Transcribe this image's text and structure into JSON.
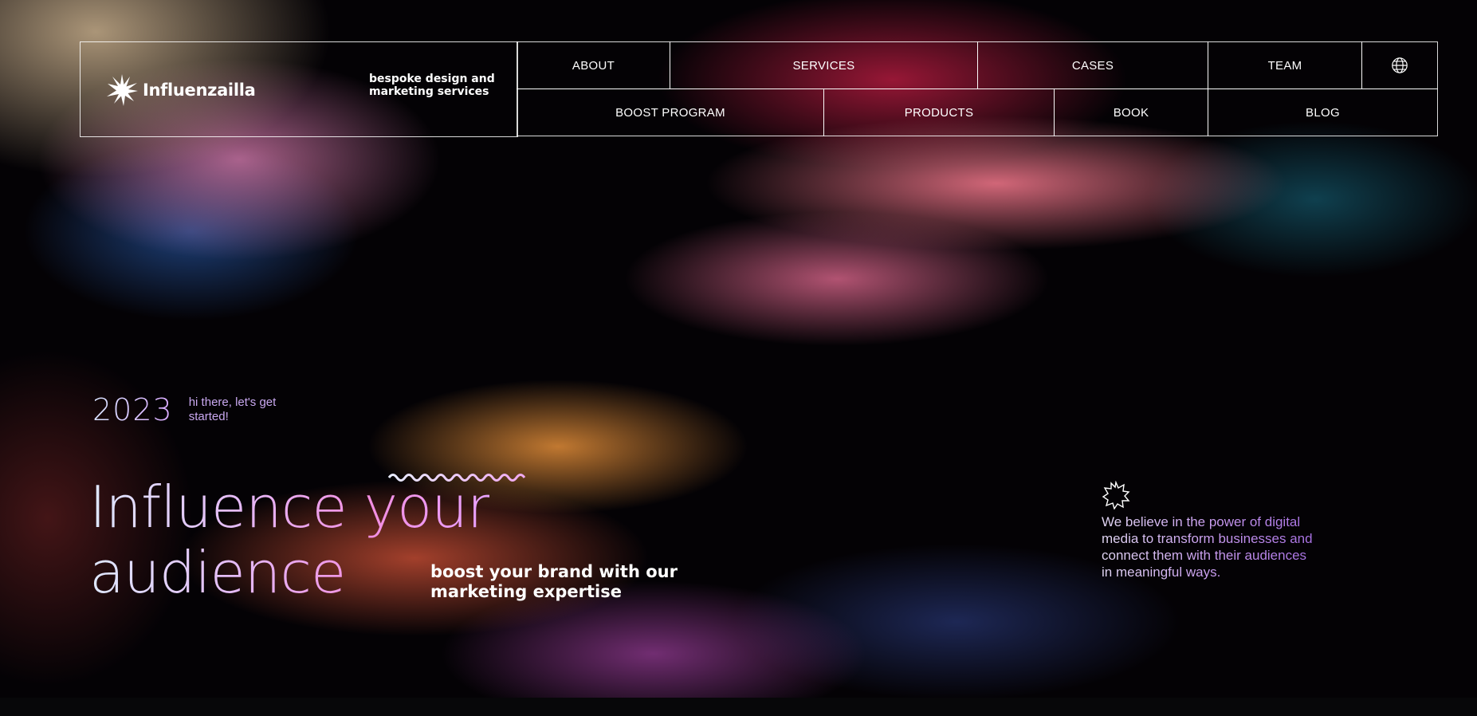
{
  "brand": {
    "name": "Influenzailla",
    "tagline": "bespoke design and marketing services"
  },
  "nav": {
    "row1": [
      {
        "label": "ABOUT"
      },
      {
        "label": "SERVICES"
      },
      {
        "label": "CASES"
      },
      {
        "label": "TEAM"
      }
    ],
    "row2": [
      {
        "label": "BOOST PROGRAM"
      },
      {
        "label": "PRODUCTS"
      },
      {
        "label": "BOOK"
      },
      {
        "label": "BLOG"
      }
    ],
    "language_icon": "globe-icon"
  },
  "hero": {
    "year": "2023",
    "greeting": "hi there, let's get started!",
    "headline_line1": "Influence your",
    "headline_line2": "audience",
    "subheadline": "boost your brand with our marketing expertise",
    "belief_icon": "starburst-icon",
    "belief": "We believe in the power of digital media to transform businesses and connect them with their audiences in meaningful ways."
  },
  "colors": {
    "text": "#ffffff",
    "accent_purple": "#c899f0",
    "accent_pink": "#f28ee0",
    "background": "#040205"
  }
}
